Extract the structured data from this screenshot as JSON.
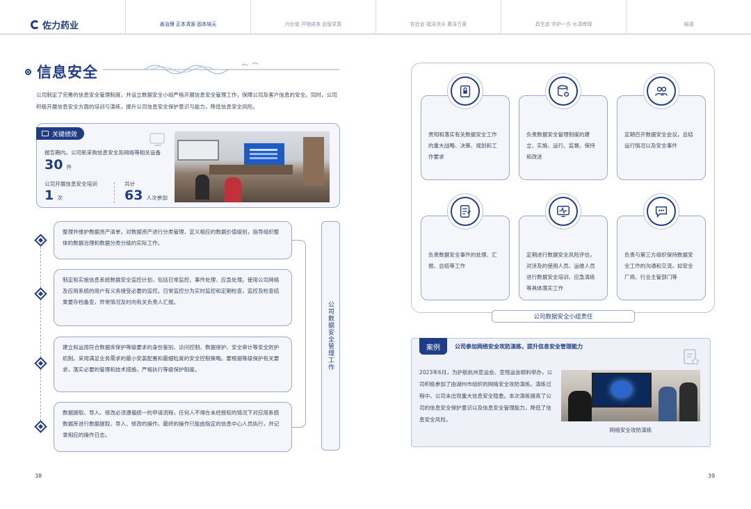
{
  "header": {
    "logo_text": "佐力药业",
    "nav": [
      {
        "label": "善治理 正本清源 固本培元",
        "active": true
      },
      {
        "label": "兴价值 开物成务 启智求真",
        "active": false
      },
      {
        "label": "佐社会 福泽济众 惠泽万家",
        "active": false
      },
      {
        "label": "具生态 守护一方 水清岸绿",
        "active": false
      },
      {
        "label": "结语",
        "active": false
      }
    ]
  },
  "left_page": {
    "section_title": "信息安全",
    "intro": "公司制定了完善的信息安全管理制度，并设立数据安全小组严格开展信息安全管理工作，保障公司及客户信息的安全。同时，公司积极开展信息安全方面的培训与演练，提升公司信息安全保护意识与能力，降低信息安全风险。",
    "kpi": {
      "badge": "关键绩效",
      "line1": "报告期内，公司新采购信息安全及网络等相关设备",
      "num1": "30",
      "unit1": "件",
      "line2": "公司开展信息安全培训",
      "num2": "1",
      "unit2": "次",
      "line3": "共计",
      "num3": "63",
      "unit3": "人次参加"
    },
    "items": [
      "整理并维护数据资产清单，对数据资产进行分类管理，定义相应的数据价值级别，指导组织整体的数据治理和数据分类分级的实际工作。",
      "制定和实施信息系统数据安全监控计划，包括日常监控、事件处理、应急处理。使用公司网络及应用系统的用户有义务接受必要的监控。日常监控分为实时监控和定期检查，监控及检查结果要存档备查，异常情况及时向有关负责人汇报。",
      "建立和运用符合数据库保护等级要求的身份鉴别、访问控制、数据保护、安全审计等安全防护机制。采用满足业务需求的最小安装配置和最细粒度的安全控制策略。要根据等级保护有关要求，落实必要的管理和技术措施，严格执行等级保护制度。",
      "数据提取、导入、修改必须遵循统一的申请流程，任何人不得在未经授权的情况下对应用系统数据库进行数据提取、导入、修改的操作。最终的操作只能由指定的信息中心人员执行，并记录相应的操作日志。"
    ],
    "vertical_label": "公司数据安全管理工作",
    "page_number": "38"
  },
  "right_page": {
    "cards": [
      {
        "icon": "lock-doc-icon",
        "text": "贯彻和落实有关数据安全工作的重大战略、决策、规划和工作要求"
      },
      {
        "icon": "database-gear-icon",
        "text": "负责数据安全管理制度的建立、实施、运行、监督、保持和改进"
      },
      {
        "icon": "people-group-icon",
        "text": "定期召开数据安全会议，总结运行情况以及安全事件"
      },
      {
        "icon": "document-edit-icon",
        "text": "负责数据安全事件的处理、汇报、总结等工作"
      },
      {
        "icon": "monitor-pulse-icon",
        "text": "定期进行数据安全风险评估，对涉及的使用人员、运维人员进行数据安全培训、应急演练等具体落实工作"
      },
      {
        "icon": "chat-bubble-icon",
        "text": "负责与第三方组织保持数据安全工作的沟通和交流，如安全厂商、行业主管部门等"
      }
    ],
    "frame_label": "公司数据安全小组责任",
    "case": {
      "badge": "案例",
      "title": "公司参加网络安全攻防演练，提升信息安全管理能力",
      "text": "2023年6月，为护航杭州亚运会、亚残运会顺利举办，公司积极参加了由湖州市组织的网络安全攻防演练。演练过程中，公司未出现重大信息安全隐患。本次演练提高了公司的信息安全保护意识以及信息安全管理能力，降低了信息安全风险。",
      "photo_caption": "网络安全攻防演练"
    },
    "page_number": "39"
  }
}
